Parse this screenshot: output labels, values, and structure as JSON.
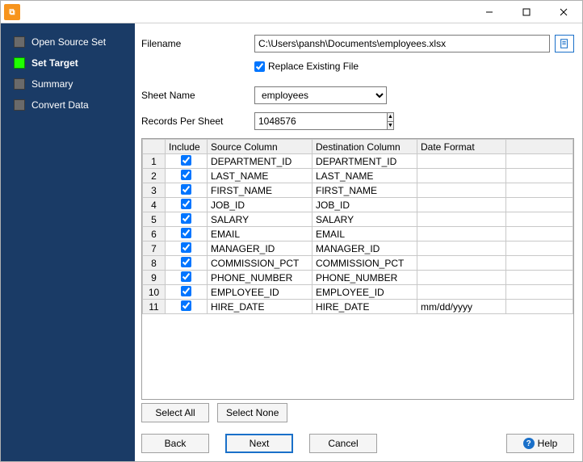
{
  "titlebar": {
    "minimize_title": "Minimize",
    "maximize_title": "Maximize",
    "close_title": "Close"
  },
  "sidebar": {
    "items": [
      {
        "label": "Open Source Set",
        "active": false
      },
      {
        "label": "Set Target",
        "active": true
      },
      {
        "label": "Summary",
        "active": false
      },
      {
        "label": "Convert Data",
        "active": false
      }
    ]
  },
  "form": {
    "filename_label": "Filename",
    "filename_value": "C:\\Users\\pansh\\Documents\\employees.xlsx",
    "replace_label": "Replace Existing File",
    "replace_checked": true,
    "sheet_label": "Sheet Name",
    "sheet_value": "employees",
    "records_label": "Records Per Sheet",
    "records_value": "1048576"
  },
  "grid": {
    "headers": {
      "rownum": "",
      "include": "Include",
      "source": "Source Column",
      "dest": "Destination Column",
      "date": "Date Format"
    },
    "rows": [
      {
        "n": "1",
        "inc": true,
        "src": "DEPARTMENT_ID",
        "dst": "DEPARTMENT_ID",
        "date": ""
      },
      {
        "n": "2",
        "inc": true,
        "src": "LAST_NAME",
        "dst": "LAST_NAME",
        "date": ""
      },
      {
        "n": "3",
        "inc": true,
        "src": "FIRST_NAME",
        "dst": "FIRST_NAME",
        "date": ""
      },
      {
        "n": "4",
        "inc": true,
        "src": "JOB_ID",
        "dst": "JOB_ID",
        "date": ""
      },
      {
        "n": "5",
        "inc": true,
        "src": "SALARY",
        "dst": "SALARY",
        "date": ""
      },
      {
        "n": "6",
        "inc": true,
        "src": "EMAIL",
        "dst": "EMAIL",
        "date": ""
      },
      {
        "n": "7",
        "inc": true,
        "src": "MANAGER_ID",
        "dst": "MANAGER_ID",
        "date": ""
      },
      {
        "n": "8",
        "inc": true,
        "src": "COMMISSION_PCT",
        "dst": "COMMISSION_PCT",
        "date": ""
      },
      {
        "n": "9",
        "inc": true,
        "src": "PHONE_NUMBER",
        "dst": "PHONE_NUMBER",
        "date": ""
      },
      {
        "n": "10",
        "inc": true,
        "src": "EMPLOYEE_ID",
        "dst": "EMPLOYEE_ID",
        "date": ""
      },
      {
        "n": "11",
        "inc": true,
        "src": "HIRE_DATE",
        "dst": "HIRE_DATE",
        "date": "mm/dd/yyyy"
      }
    ]
  },
  "buttons": {
    "select_all": "Select All",
    "select_none": "Select None",
    "back": "Back",
    "next": "Next",
    "cancel": "Cancel",
    "help": "Help"
  }
}
